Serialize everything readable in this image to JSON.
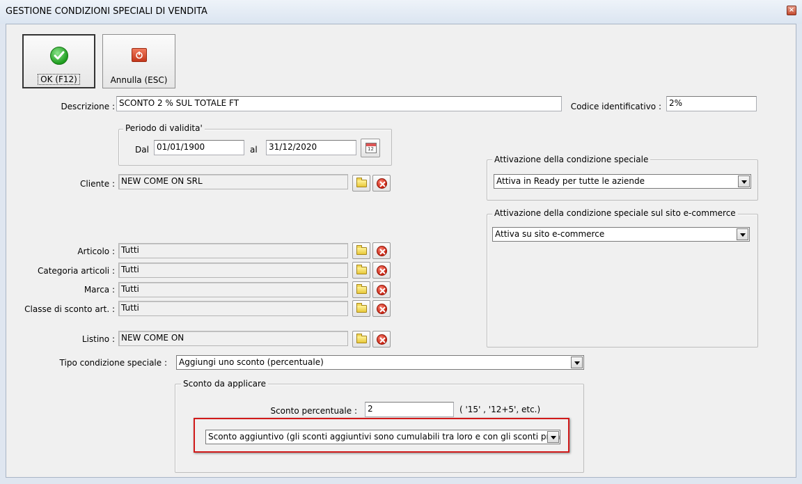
{
  "window": {
    "title": "GESTIONE CONDIZIONI SPECIALI DI VENDITA",
    "close_glyph": "×"
  },
  "toolbar": {
    "ok_label": "OK (F12)",
    "cancel_label": "Annulla (ESC)"
  },
  "form": {
    "descrizione": {
      "label": "Descrizione :",
      "value": "SCONTO 2 % SUL TOTALE FT"
    },
    "codice": {
      "label": "Codice identificativo :",
      "value": "2%"
    },
    "periodo": {
      "title": "Periodo di validita'",
      "dal_label": "Dal",
      "dal_value": "01/01/1900",
      "al_label": "al",
      "al_value": "31/12/2020",
      "calendar_glyph": "12"
    },
    "cliente": {
      "label": "Cliente :",
      "value": "NEW COME ON SRL"
    },
    "articolo": {
      "label": "Articolo :",
      "value": "Tutti"
    },
    "categoria": {
      "label": "Categoria articoli :",
      "value": "Tutti"
    },
    "marca": {
      "label": "Marca :",
      "value": "Tutti"
    },
    "classe": {
      "label": "Classe di sconto art. :",
      "value": "Tutti"
    },
    "listino": {
      "label": "Listino :",
      "value": "NEW COME ON"
    },
    "tipo": {
      "label": "Tipo condizione speciale :",
      "value": "Aggiungi uno sconto (percentuale)"
    },
    "sconto": {
      "title": "Sconto da applicare",
      "percent_label": "Sconto percentuale :",
      "percent_value": "2",
      "hint": "( '15' ,  '12+5', etc.)",
      "mode_value": "Sconto aggiuntivo (gli sconti aggiuntivi sono cumulabili tra loro e con gli sconti prima"
    }
  },
  "attivazione": {
    "title": "Attivazione della condizione speciale",
    "value": "Attiva in Ready per tutte le aziende"
  },
  "attivazione_ecom": {
    "title": "Attivazione della condizione speciale sul sito e-commerce",
    "value": "Attiva su sito e-commerce"
  },
  "icons": {
    "ok": "check-icon",
    "cancel": "power-icon",
    "browse": "folder-icon",
    "clear": "delete-icon",
    "calendar": "calendar-icon",
    "dropdown": "chevron-down-icon"
  },
  "colors": {
    "highlight": "#d11a1a",
    "background": "#f0f0f0"
  }
}
